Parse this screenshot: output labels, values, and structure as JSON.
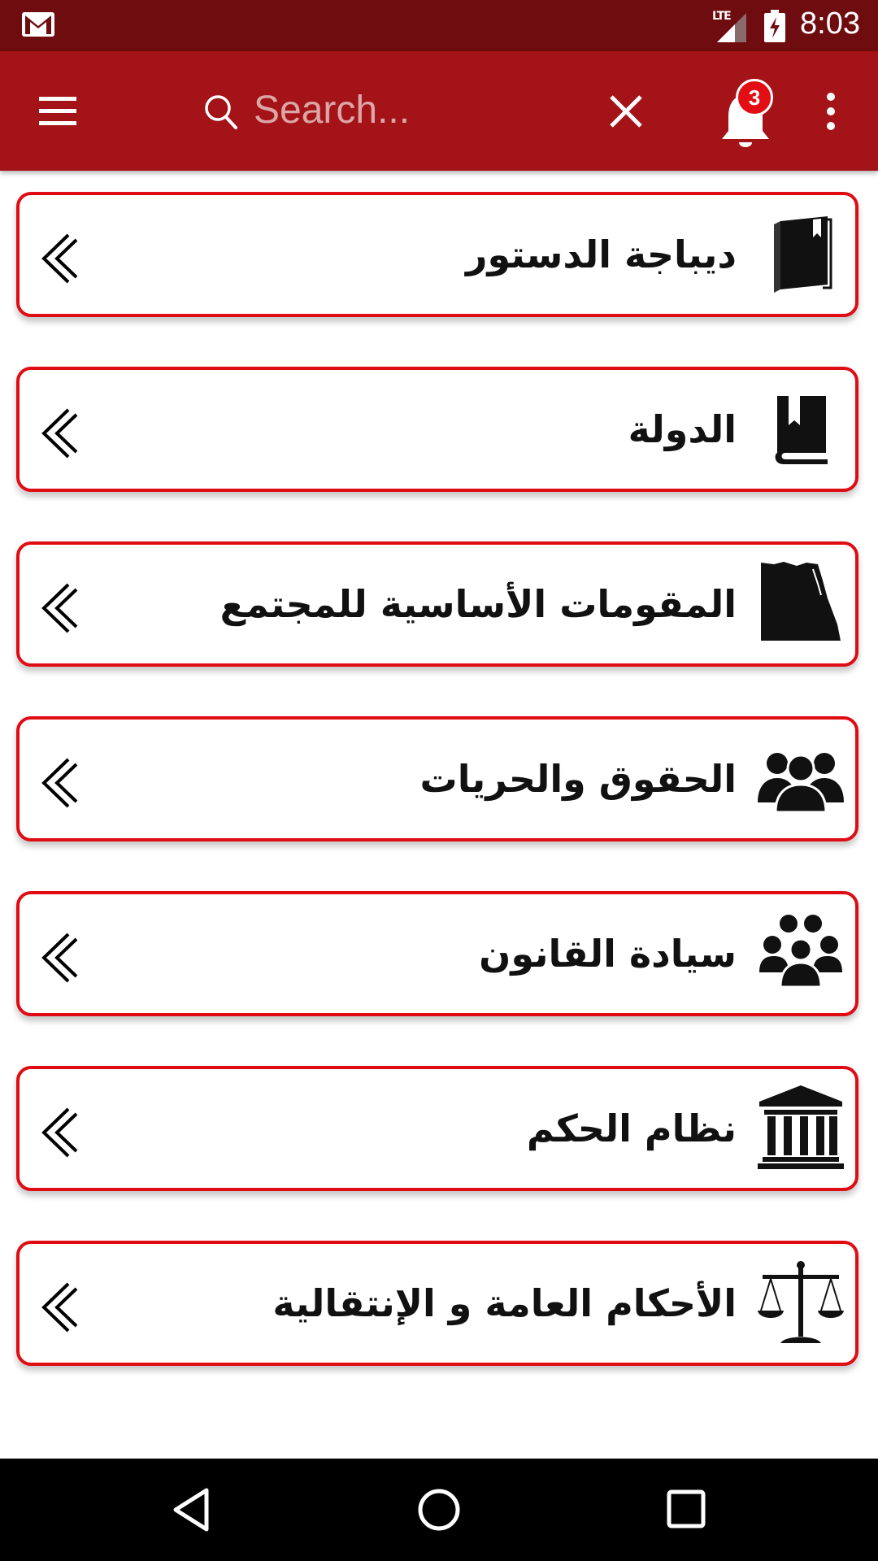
{
  "status_bar": {
    "time": "8:03",
    "network": "LTE"
  },
  "app_bar": {
    "search_placeholder": "Search...",
    "notification_count": "3"
  },
  "sections": [
    {
      "label": "ديباجة الدستور",
      "icon": "closed-book-icon"
    },
    {
      "label": "الدولة",
      "icon": "open-book-icon"
    },
    {
      "label": "المقومات الأساسية للمجتمع",
      "icon": "egypt-map-icon"
    },
    {
      "label": "الحقوق والحريات",
      "icon": "people-group-icon"
    },
    {
      "label": "سيادة القانون",
      "icon": "crowd-icon"
    },
    {
      "label": "نظام الحكم",
      "icon": "courthouse-icon"
    },
    {
      "label": "الأحكام العامة و الإنتقالية",
      "icon": "scales-icon"
    }
  ],
  "colors": {
    "status_bar": "#6e0c0f",
    "app_bar": "#a31317",
    "card_border": "#e00c14",
    "badge": "#e30d14"
  }
}
